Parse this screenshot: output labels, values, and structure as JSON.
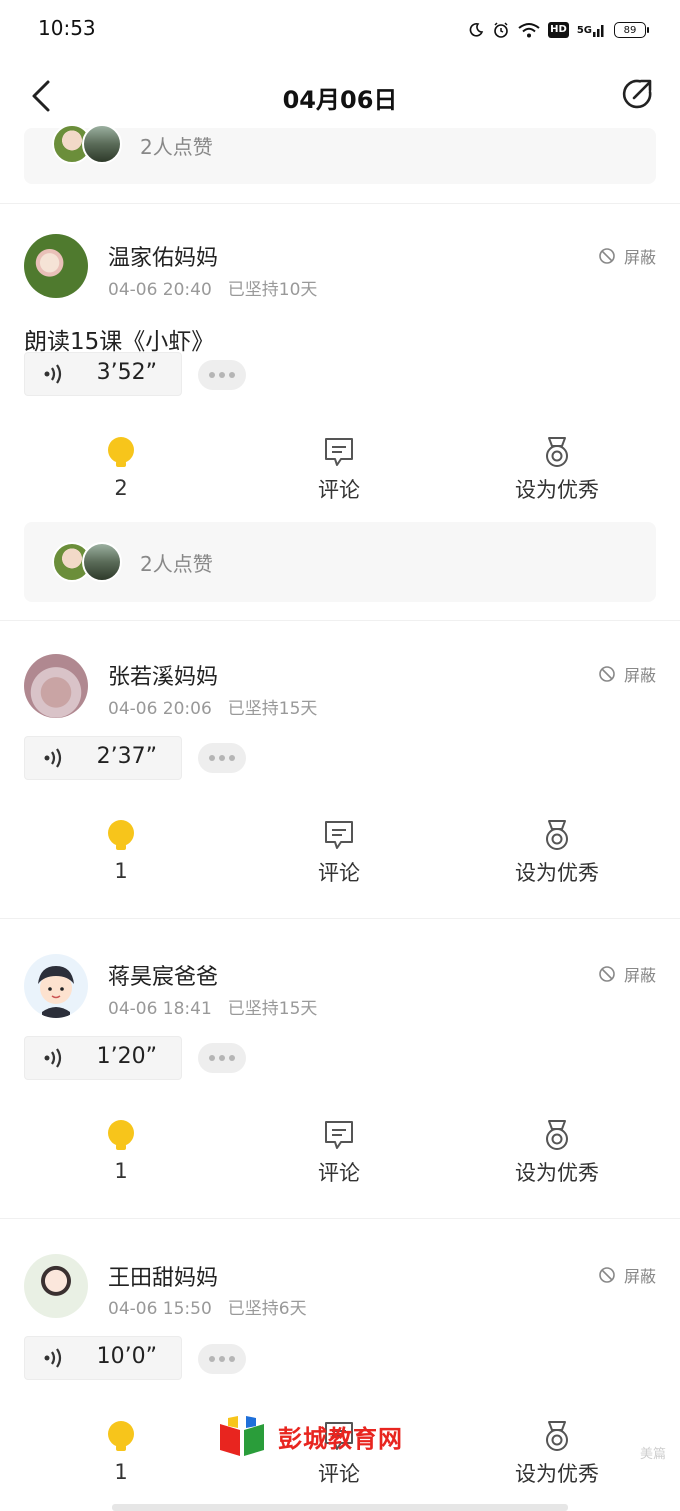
{
  "status_bar": {
    "time": "10:53",
    "battery": "89",
    "network": "5G",
    "hd": "HD"
  },
  "header": {
    "title": "04月06日"
  },
  "top_likes": {
    "text": "2人点赞"
  },
  "posts": [
    {
      "name": "温家佑妈妈",
      "time": "04-06 20:40",
      "streak": "已坚持10天",
      "mute_label": "屏蔽",
      "text": "朗读15课《小虾》",
      "duration": "3’52”",
      "like_count": "2",
      "comment_label": "评论",
      "excellent_label": "设为优秀",
      "likes_text": "2人点赞"
    },
    {
      "name": "张若溪妈妈",
      "time": "04-06 20:06",
      "streak": "已坚持15天",
      "mute_label": "屏蔽",
      "duration": "2’37”",
      "like_count": "1",
      "comment_label": "评论",
      "excellent_label": "设为优秀"
    },
    {
      "name": "蒋昊宸爸爸",
      "time": "04-06 18:41",
      "streak": "已坚持15天",
      "mute_label": "屏蔽",
      "duration": "1’20”",
      "like_count": "1",
      "comment_label": "评论",
      "excellent_label": "设为优秀"
    },
    {
      "name": "王田甜妈妈",
      "time": "04-06 15:50",
      "streak": "已坚持6天",
      "mute_label": "屏蔽",
      "duration": "10’0”",
      "like_count": "1",
      "comment_label": "评论",
      "excellent_label": "设为优秀"
    }
  ],
  "watermark": {
    "text": "彭城教育网",
    "sub": "美篇"
  },
  "colors": {
    "accent": "#f7c51b",
    "muted": "#999999",
    "primary_text": "#222222",
    "watermark_red": "#e8251f"
  },
  "icons": [
    "back-arrow-icon",
    "share-icon",
    "block-icon",
    "voice-wave-icon",
    "more-dots-icon",
    "lightbulb-icon",
    "comment-icon",
    "medal-icon"
  ]
}
